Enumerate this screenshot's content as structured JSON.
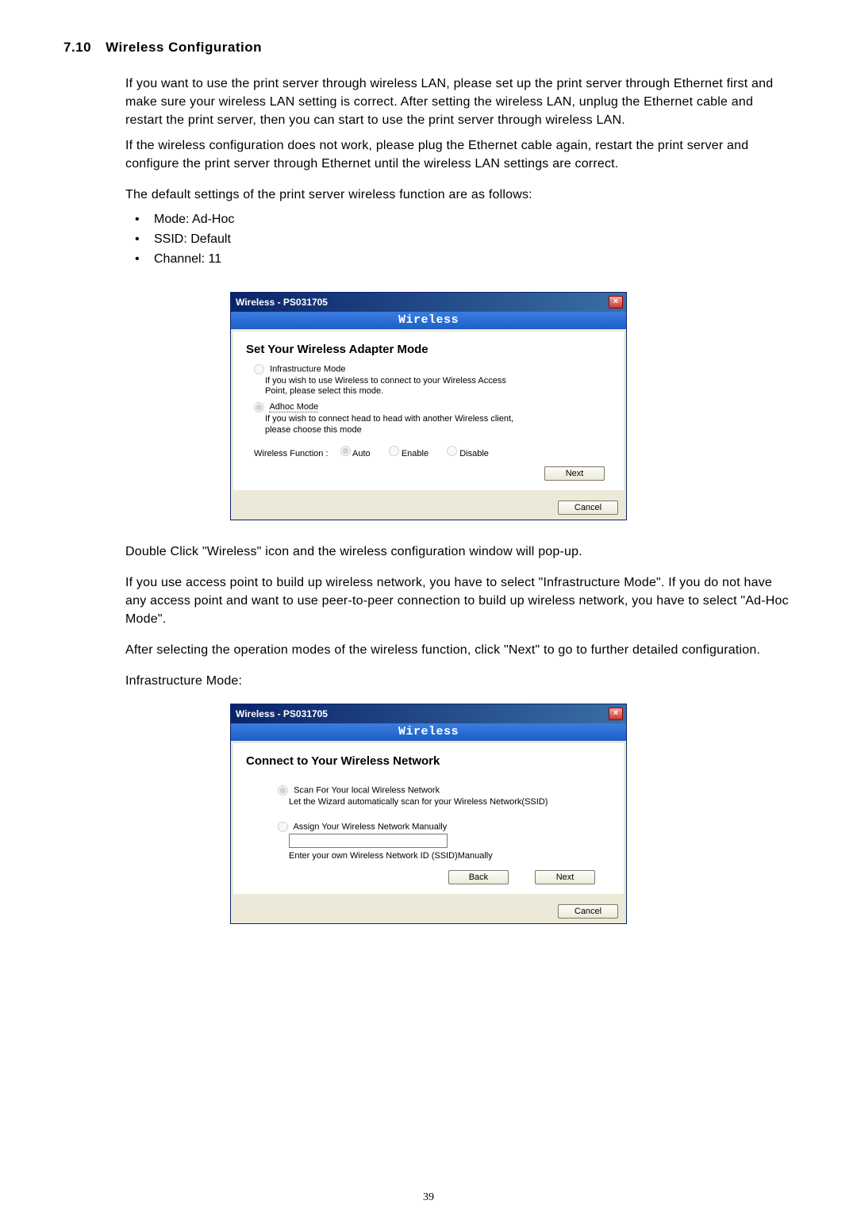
{
  "section": {
    "number": "7.10",
    "title": "Wireless Configuration"
  },
  "paragraphs": {
    "p1": " If you want to use the print server through wireless LAN, please set up the print server through Ethernet first and make sure your wireless LAN setting is correct. After setting the wireless LAN, unplug the Ethernet cable and restart the print server, then you can start to use the print server through wireless LAN.",
    "p2": "If the wireless configuration does not work, please plug the Ethernet cable again, restart the print server and configure the print server through Ethernet until the wireless LAN settings are correct.",
    "p3": "The default settings of the print server wireless function are as follows:",
    "p4": "Double Click \"Wireless\" icon and the wireless configuration window will pop-up.",
    "p5": "If you use access point to build up wireless network, you have to select \"Infrastructure Mode\". If you do not have any access point and want to use peer-to-peer connection to build up wireless network, you have to select \"Ad-Hoc Mode\".",
    "p6": "After selecting the operation modes of the wireless function, click \"Next\" to go to further detailed configuration.",
    "p7": "Infrastructure Mode:"
  },
  "bullets": [
    "Mode: Ad-Hoc",
    "SSID: Default",
    "Channel: 11"
  ],
  "win1": {
    "title": "Wireless - PS031705",
    "band": "Wireless",
    "heading": "Set Your Wireless Adapter Mode",
    "infra_label": "Infrastructure Mode",
    "infra_desc": "If you wish to use Wireless to connect to your Wireless Access Point, please select this mode.",
    "adhoc_label": "Adhoc Mode",
    "adhoc_desc": "If you wish to connect head to head with another Wireless client, please choose this mode",
    "wf_label": "Wireless Function :",
    "wf_auto": "Auto",
    "wf_enable": "Enable",
    "wf_disable": "Disable",
    "next": "Next",
    "cancel": "Cancel"
  },
  "win2": {
    "title": "Wireless - PS031705",
    "band": "Wireless",
    "heading": "Connect to Your Wireless Network",
    "scan_label": "Scan For Your local Wireless Network",
    "scan_desc": "Let the Wizard automatically scan for your Wireless Network(SSID)",
    "manual_label": "Assign Your Wireless Network Manually",
    "manual_desc": "Enter your own Wireless Network ID (SSID)Manually",
    "back": "Back",
    "next": "Next",
    "cancel": "Cancel"
  },
  "page_number": "39"
}
